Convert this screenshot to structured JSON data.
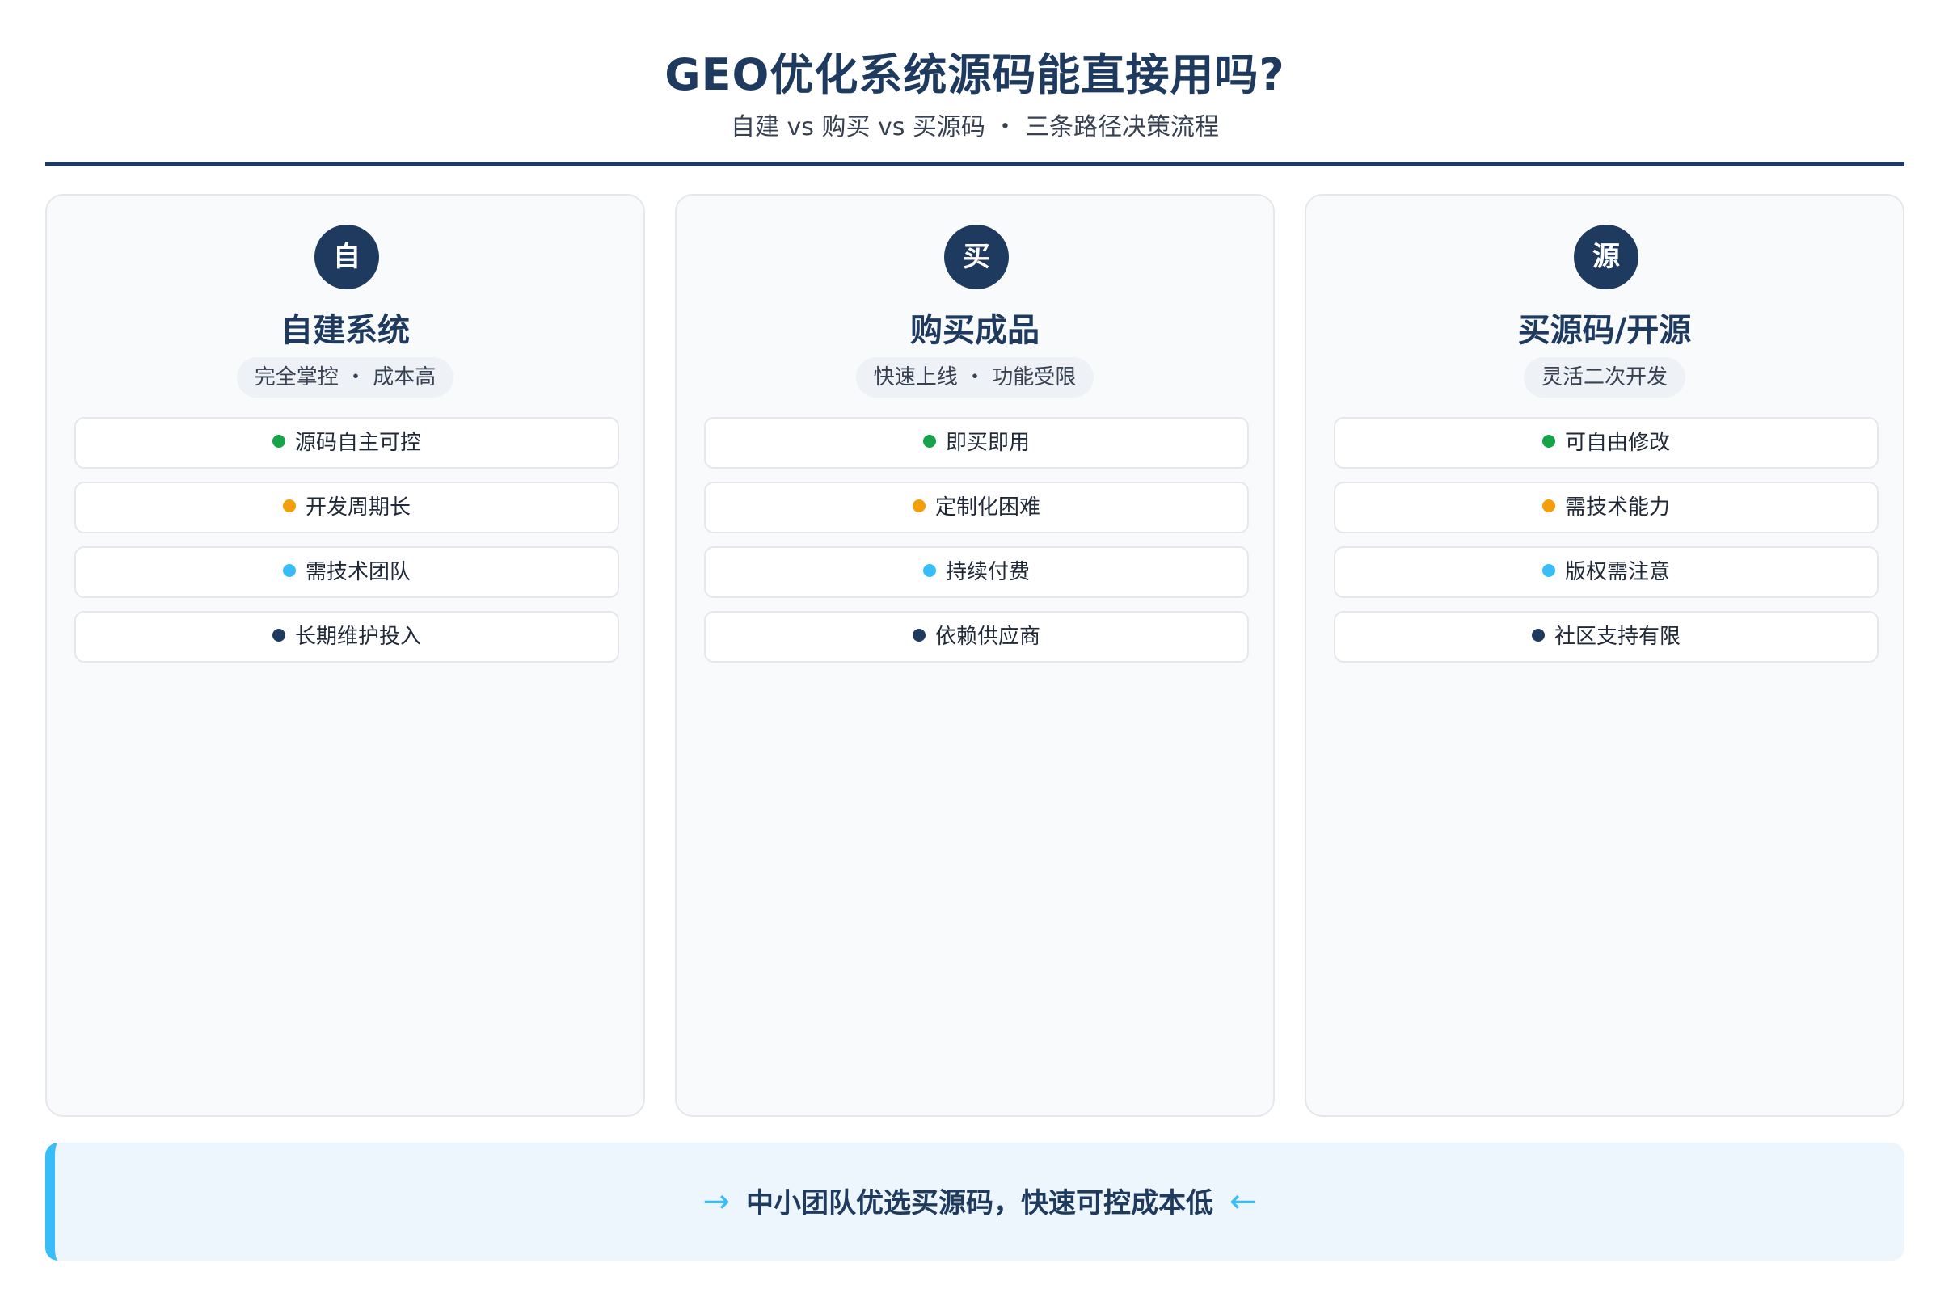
{
  "header": {
    "title": "GEO优化系统源码能直接用吗?",
    "subtitle": "自建 vs 购买 vs 买源码 ・ 三条路径决策流程"
  },
  "colors": {
    "primary": "#1e3a5f",
    "green": "#16a34a",
    "orange": "#f59e0b",
    "sky": "#38bdf8",
    "navy": "#1e3a5f"
  },
  "columns": [
    {
      "badge": "自",
      "title": "自建系统",
      "tag": "完全掌控 ・ 成本高",
      "items": [
        "源码自主可控",
        "开发周期长",
        "需技术团队",
        "长期维护投入"
      ]
    },
    {
      "badge": "买",
      "title": "购买成品",
      "tag": "快速上线 ・ 功能受限",
      "items": [
        "即买即用",
        "定制化困难",
        "持续付费",
        "依赖供应商"
      ]
    },
    {
      "badge": "源",
      "title": "买源码/开源",
      "tag": "灵活二次开发",
      "items": [
        "可自由修改",
        "需技术能力",
        "版权需注意",
        "社区支持有限"
      ]
    }
  ],
  "footer": {
    "arrow_left": "→",
    "text": "中小团队优选买源码，快速可控成本低",
    "arrow_right": "←"
  }
}
